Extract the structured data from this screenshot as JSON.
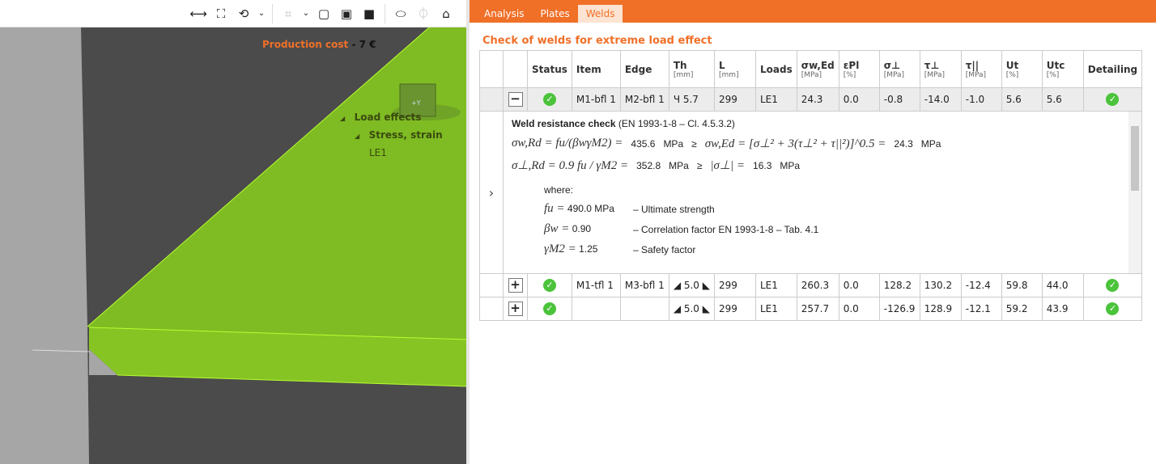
{
  "toolbar": {
    "icons": [
      "ruler-icon",
      "fit-view-icon",
      "rotate-icon",
      "chevron-down-icon",
      "crop-icon",
      "chevron-down-icon",
      "wireframe-cube-icon",
      "transparent-cube-icon",
      "solid-cube-icon",
      "section-icon",
      "mirror-icon",
      "home-icon"
    ]
  },
  "viewport": {
    "cost_label": "Production cost",
    "cost_sep": "-",
    "cost_value": "7 €",
    "tree": {
      "load_effects": "Load effects",
      "stress_strain": "Stress, strain",
      "le": "LE1"
    },
    "cube_label": "+Y",
    "colors": {
      "plate": "#82be23",
      "background": "#4b4b4b",
      "column": "#a6a6a6"
    }
  },
  "tabs": [
    {
      "label": "Analysis"
    },
    {
      "label": "Plates"
    },
    {
      "label": "Welds",
      "active": true
    }
  ],
  "section_title": "Check of welds for extreme load effect",
  "columns": [
    {
      "h": "",
      "u": ""
    },
    {
      "h": "",
      "u": ""
    },
    {
      "h": "Status",
      "u": ""
    },
    {
      "h": "Item",
      "u": ""
    },
    {
      "h": "Edge",
      "u": ""
    },
    {
      "h": "Th",
      "u": "[mm]"
    },
    {
      "h": "L",
      "u": "[mm]"
    },
    {
      "h": "Loads",
      "u": ""
    },
    {
      "h": "σw,Ed",
      "u": "[MPa]"
    },
    {
      "h": "εPl",
      "u": "[%]"
    },
    {
      "h": "σ⊥",
      "u": "[MPa]"
    },
    {
      "h": "τ⊥",
      "u": "[MPa]"
    },
    {
      "h": "τ||",
      "u": "[MPa]"
    },
    {
      "h": "Ut",
      "u": "[%]"
    },
    {
      "h": "Utc",
      "u": "[%]"
    },
    {
      "h": "Detailing",
      "u": ""
    }
  ],
  "rows": [
    {
      "toggle": "−",
      "item": "M1-bfl 1",
      "edge": "M2-bfl 1",
      "th": "Ч 5.7",
      "l": "299",
      "loads": "LE1",
      "sw": "24.3",
      "ep": "0.0",
      "sp": "-0.8",
      "tp": "-14.0",
      "tl": "-1.0",
      "ut": "5.6",
      "utc": "5.6"
    },
    {
      "toggle": "+",
      "item": "M1-tfl 1",
      "edge": "M3-bfl 1",
      "th": "◢ 5.0 ◣",
      "l": "299",
      "loads": "LE1",
      "sw": "260.3",
      "ep": "0.0",
      "sp": "128.2",
      "tp": "130.2",
      "tl": "-12.4",
      "ut": "59.8",
      "utc": "44.0"
    },
    {
      "toggle": "+",
      "item": "",
      "edge": "",
      "th": "◢ 5.0 ◣",
      "l": "299",
      "loads": "LE1",
      "sw": "257.7",
      "ep": "0.0",
      "sp": "-126.9",
      "tp": "128.9",
      "tl": "-12.1",
      "ut": "59.2",
      "utc": "43.9"
    }
  ],
  "detail": {
    "expander": "›",
    "heading": "Weld resistance check",
    "heading_ref": "(EN 1993-1-8 – Cl. 4.5.3.2)",
    "f1": "σw,Rd = fu/(βwγM2) =",
    "v1": "435.6",
    "u": "MPa",
    "ge": "≥",
    "f1b": "σw,Ed = [σ⊥² + 3(τ⊥² + τ||²)]^0.5 =",
    "v1b": "24.3",
    "f2": "σ⊥,Rd = 0.9 fu / γM2 =",
    "v2": "352.8",
    "f2b": "|σ⊥| =",
    "v2b": "16.3",
    "where": "where:",
    "params": [
      {
        "sym": "fu =",
        "val": "490.0 MPa",
        "desc": "– Ultimate strength"
      },
      {
        "sym": "βw =",
        "val": "0.90",
        "desc": "– Correlation factor EN 1993-1-8 – Tab. 4.1"
      },
      {
        "sym": "γM2 =",
        "val": "1.25",
        "desc": "– Safety factor"
      }
    ]
  }
}
